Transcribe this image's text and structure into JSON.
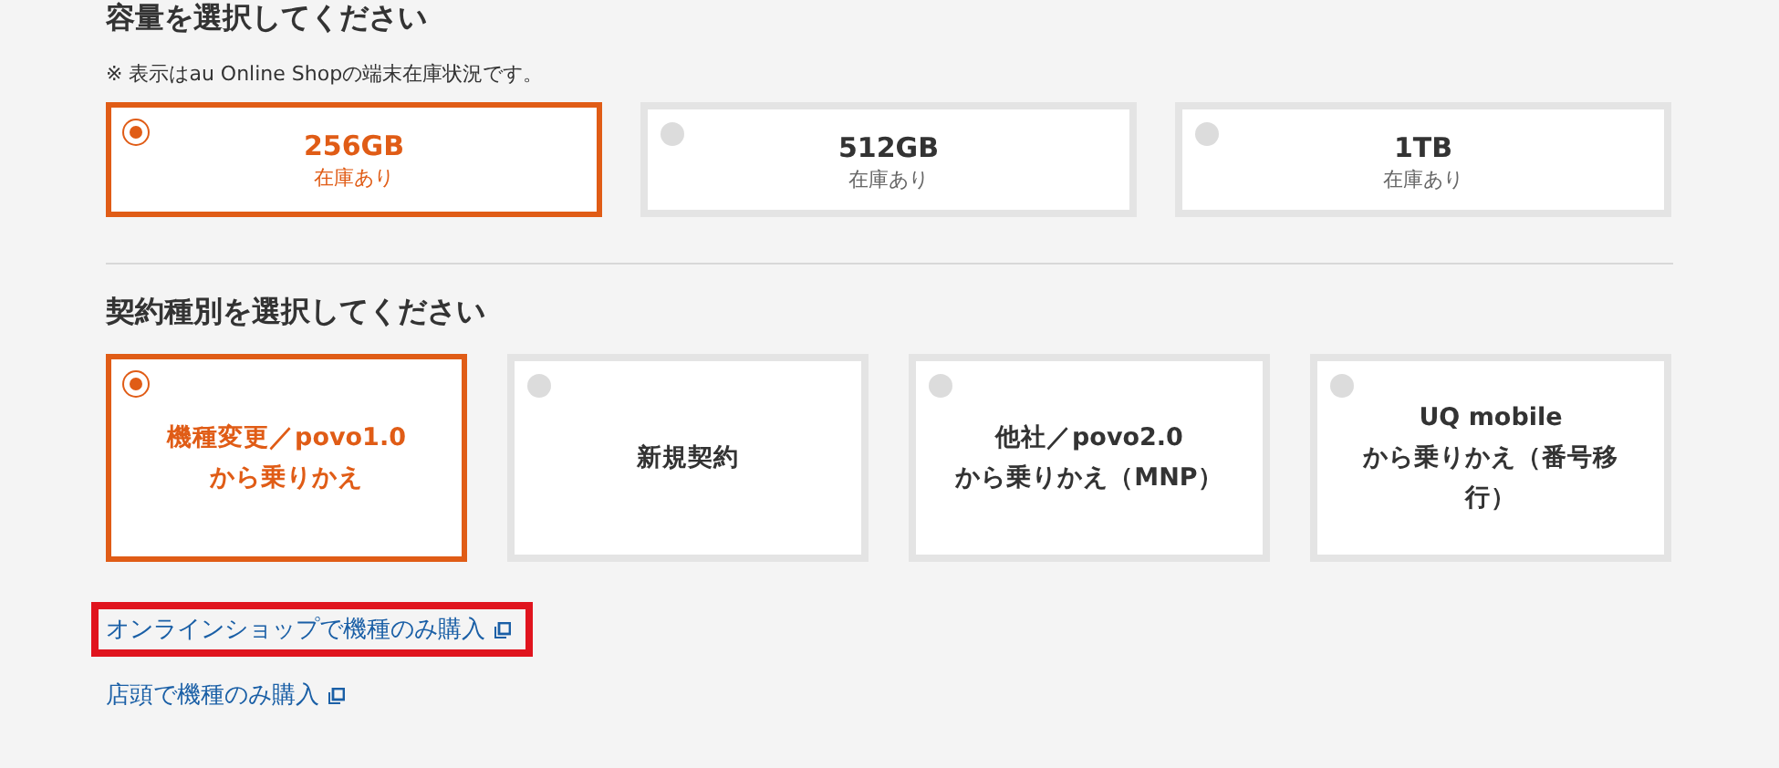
{
  "capacity": {
    "title": "容量を選択してください",
    "note": "※ 表示はau Online Shopの端末在庫状況です。",
    "options": [
      {
        "label": "256GB",
        "stock": "在庫あり",
        "selected": true
      },
      {
        "label": "512GB",
        "stock": "在庫あり",
        "selected": false
      },
      {
        "label": "1TB",
        "stock": "在庫あり",
        "selected": false
      }
    ]
  },
  "contract": {
    "title": "契約種別を選択してください",
    "options": [
      {
        "lines": [
          "機種変更／povo1.0",
          "から乗りかえ"
        ],
        "selected": true
      },
      {
        "lines": [
          "新規契約"
        ],
        "selected": false
      },
      {
        "lines": [
          "他社／povo2.0",
          "から乗りかえ（MNP）"
        ],
        "selected": false
      },
      {
        "lines": [
          "UQ mobile",
          "から乗りかえ（番号移",
          "行）"
        ],
        "selected": false
      }
    ]
  },
  "links": [
    {
      "label": "オンラインショップで機種のみ購入",
      "highlighted": true
    },
    {
      "label": "店頭で機種のみ購入",
      "highlighted": false
    }
  ]
}
